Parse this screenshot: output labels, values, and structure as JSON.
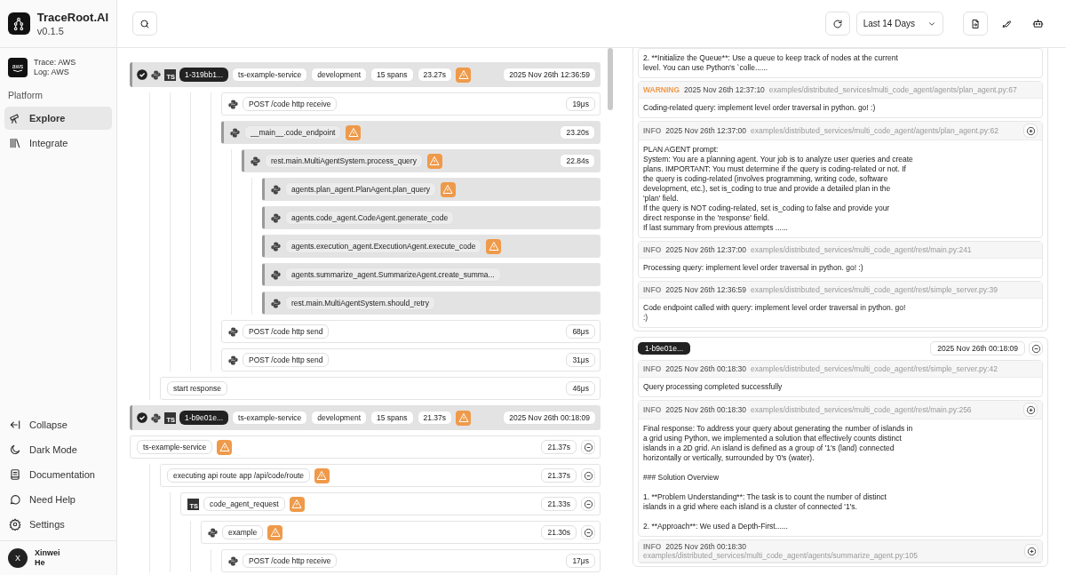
{
  "app": {
    "name": "TraceRoot.AI",
    "version": "v0.1.5"
  },
  "provider": {
    "logo_text": "aws",
    "trace": "Trace: AWS",
    "log": "Log: AWS"
  },
  "sidebar": {
    "section": "Platform",
    "items": [
      {
        "label": "Explore",
        "kind": "telescope",
        "selected": true
      },
      {
        "label": "Integrate",
        "kind": "books",
        "selected": false
      }
    ],
    "bottom_items": [
      {
        "label": "Collapse",
        "kind": "collapse"
      },
      {
        "label": "Dark Mode",
        "kind": "moon"
      },
      {
        "label": "Documentation",
        "kind": "book"
      },
      {
        "label": "Need Help",
        "kind": "chat"
      },
      {
        "label": "Settings",
        "kind": "gear"
      }
    ]
  },
  "user": {
    "initial": "X",
    "name": "Xinwei He"
  },
  "toolbar": {
    "time_range": "Last 14 Days"
  },
  "traces": [
    {
      "selected": true,
      "languages": [
        {
          "kind": "python"
        },
        {
          "kind": "ts",
          "badge": "TS"
        }
      ],
      "id": "1-319bb1...",
      "service": "ts-example-service",
      "environment": "development",
      "span_count": "15 spans",
      "duration": "23.27s",
      "warning": true,
      "timestamp": "2025 Nov 26th 12:36:59",
      "spans": [
        {
          "children": [
            {
              "children": [
                {
                  "children": [
                    {
                      "children": [
                        {
                          "kind": "python",
                          "name": "POST /code http receive",
                          "duration": "19μs",
                          "warning": false,
                          "highlighted": false
                        },
                        {
                          "kind": "python",
                          "name": "__main__.code_endpoint",
                          "duration": "23.20s",
                          "warning": true,
                          "highlighted": true,
                          "children": [
                            {
                              "kind": "python",
                              "name": "rest.main.MultiAgentSystem.process_query",
                              "duration": "22.84s",
                              "warning": true,
                              "highlighted": true,
                              "children": [
                                {
                                  "kind": "python",
                                  "name": "agents.plan_agent.PlanAgent.plan_query",
                                  "warning": true,
                                  "highlighted": true
                                },
                                {
                                  "kind": "python",
                                  "name": "agents.code_agent.CodeAgent.generate_code",
                                  "warning": false,
                                  "highlighted": true
                                },
                                {
                                  "kind": "python",
                                  "name": "agents.execution_agent.ExecutionAgent.execute_code",
                                  "warning": true,
                                  "highlighted": true
                                },
                                {
                                  "kind": "python",
                                  "name": "agents.summarize_agent.SummarizeAgent.create_summa...",
                                  "warning": false,
                                  "highlighted": true
                                },
                                {
                                  "kind": "python",
                                  "name": "rest.main.MultiAgentSystem.should_retry",
                                  "warning": false,
                                  "highlighted": true
                                }
                              ]
                            }
                          ]
                        },
                        {
                          "kind": "python",
                          "name": "POST /code http send",
                          "duration": "68μs",
                          "warning": false,
                          "highlighted": false
                        },
                        {
                          "kind": "python",
                          "name": "POST /code http send",
                          "duration": "31μs",
                          "warning": false,
                          "highlighted": false
                        }
                      ]
                    }
                  ]
                }
              ]
            },
            {
              "name": "start response",
              "duration": "46μs",
              "warning": false,
              "highlighted": false
            }
          ]
        }
      ]
    },
    {
      "selected": true,
      "languages": [
        {
          "kind": "python"
        },
        {
          "kind": "ts",
          "badge": "TS"
        }
      ],
      "id": "1-b9e01e...",
      "service": "ts-example-service",
      "environment": "development",
      "span_count": "15 spans",
      "duration": "21.37s",
      "warning": true,
      "timestamp": "2025 Nov 26th 00:18:09",
      "spans": [
        {
          "name": "ts-example-service",
          "duration": "21.37s",
          "warning": true,
          "highlighted": false,
          "expanded": true,
          "children": [
            {
              "name": "executing api route app /api/code/route",
              "duration": "21.37s",
              "warning": true,
              "highlighted": false,
              "expanded": true,
              "children": [
                {
                  "kind": "ts",
                  "badge": "TS",
                  "name": "code_agent_request",
                  "duration": "21.33s",
                  "warning": true,
                  "highlighted": false,
                  "expanded": true,
                  "children": [
                    {
                      "kind": "python",
                      "name": "example",
                      "duration": "21.30s",
                      "warning": true,
                      "highlighted": false,
                      "expanded": true,
                      "children": [
                        {
                          "kind": "python",
                          "name": "POST /code http receive",
                          "duration": "17μs",
                          "warning": false,
                          "highlighted": false
                        }
                      ]
                    }
                  ]
                }
              ]
            }
          ]
        }
      ]
    }
  ],
  "log_groups": [
    {
      "entries": [
        {
          "message": "2. **Initialize the Queue**: Use a queue to keep track of nodes at the current\nlevel. You can use Python's `colle......"
        },
        {
          "level": "WARNING",
          "time": "2025 Nov 26th 12:37:10",
          "path": "examples/distributed_services/multi_code_agent/agents/plan_agent.py:67",
          "message": "Coding-related query: implement level order traversal in python. go! :)",
          "has_details": false
        },
        {
          "level": "INFO",
          "time": "2025 Nov 26th 12:37:00",
          "path": "examples/distributed_services/multi_code_agent/agents/plan_agent.py:62",
          "message": "PLAN AGENT prompt:\nSystem: You are a planning agent. Your job is to analyze user queries and create\nplans. IMPORTANT: You must determine if the query is coding-related or not. If\nthe query is coding-related (involves programming, writing code, software\ndevelopment, etc.), set is_coding to true and provide a detailed plan in the\n'plan' field.\nIf the query is NOT coding-related, set is_coding to false and provide your\ndirect response in the 'response' field.\nIf last summary from previous attempts ......",
          "has_details": true
        },
        {
          "level": "INFO",
          "time": "2025 Nov 26th 12:37:00",
          "path": "examples/distributed_services/multi_code_agent/rest/main.py:241",
          "message": "Processing query: implement level order traversal in python. go! :)",
          "has_details": false
        },
        {
          "level": "INFO",
          "time": "2025 Nov 26th 12:36:59",
          "path": "examples/distributed_services/multi_code_agent/rest/simple_server.py:39",
          "message": "Code endpoint called with query: implement level order traversal in python. go!\n:)",
          "has_details": false
        }
      ]
    },
    {
      "id": "1-b9e01e...",
      "timestamp": "2025 Nov 26th 00:18:09",
      "expanded": true,
      "entries": [
        {
          "level": "INFO",
          "time": "2025 Nov 26th 00:18:30",
          "path": "examples/distributed_services/multi_code_agent/rest/simple_server.py:42",
          "message": "Query processing completed successfully",
          "has_details": false
        },
        {
          "level": "INFO",
          "time": "2025 Nov 26th 00:18:30",
          "path": "examples/distributed_services/multi_code_agent/rest/main.py:256",
          "message": "Final response: To address your query about generating the number of islands in\na grid using Python, we implemented a solution that effectively counts distinct\nislands in a 2D grid. An island is defined as a group of '1's (land) connected\nhorizontally or vertically, surrounded by '0's (water).\n\n### Solution Overview\n\n1. **Problem Understanding**: The task is to count the number of distinct\nislands in a grid where each island is a cluster of connected '1's.\n\n2. **Approach**: We used a Depth-First......",
          "has_details": true
        },
        {
          "level": "INFO",
          "time": "2025 Nov 26th 00:18:30",
          "path": "examples/distributed_services/multi_code_agent/agents/summarize_agent.py:105",
          "has_details": true,
          "wrap_header": true
        }
      ]
    }
  ]
}
